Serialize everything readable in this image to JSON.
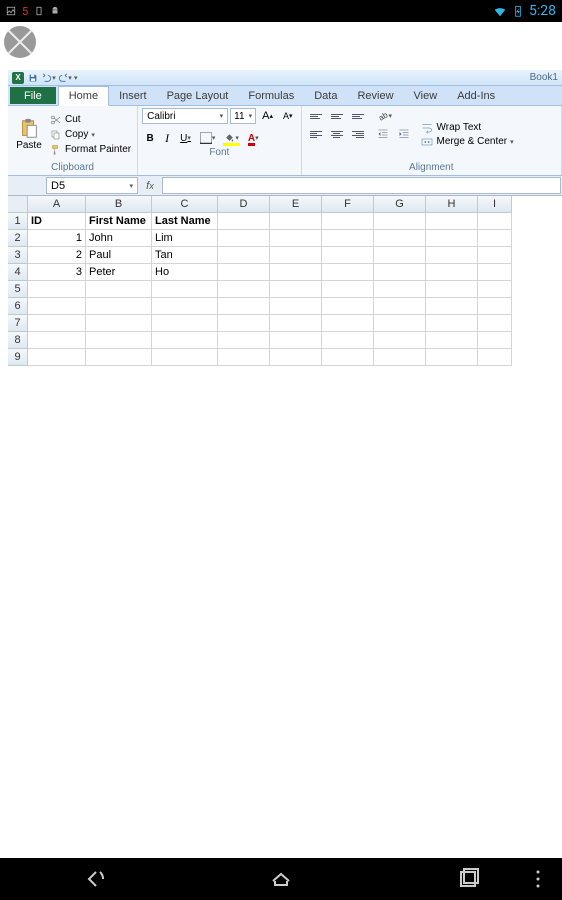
{
  "status_bar": {
    "time": "5:28",
    "notif_badge": "5"
  },
  "titlebar": {
    "book_name": "Book1"
  },
  "tabs": [
    "File",
    "Home",
    "Insert",
    "Page Layout",
    "Formulas",
    "Data",
    "Review",
    "View",
    "Add-Ins"
  ],
  "active_tab": "Home",
  "ribbon": {
    "clipboard": {
      "paste": "Paste",
      "cut": "Cut",
      "copy": "Copy",
      "format_painter": "Format Painter",
      "label": "Clipboard"
    },
    "font": {
      "name": "Calibri",
      "size": "11",
      "bold": "B",
      "italic": "I",
      "underline": "U",
      "label": "Font"
    },
    "alignment": {
      "wrap_text": "Wrap Text",
      "merge_center": "Merge & Center",
      "label": "Alignment"
    }
  },
  "namebox": "D5",
  "columns": [
    "A",
    "B",
    "C",
    "D",
    "E",
    "F",
    "G",
    "H",
    "I"
  ],
  "row_headers": [
    "1",
    "2",
    "3",
    "4",
    "5",
    "6",
    "7",
    "8",
    "9"
  ],
  "sheet": {
    "headers": [
      "ID",
      "First Name",
      "Last Name"
    ],
    "rows": [
      {
        "id": "1",
        "first": "John",
        "last": "Lim"
      },
      {
        "id": "2",
        "first": "Paul",
        "last": "Tan"
      },
      {
        "id": "3",
        "first": "Peter",
        "last": "Ho"
      }
    ]
  }
}
